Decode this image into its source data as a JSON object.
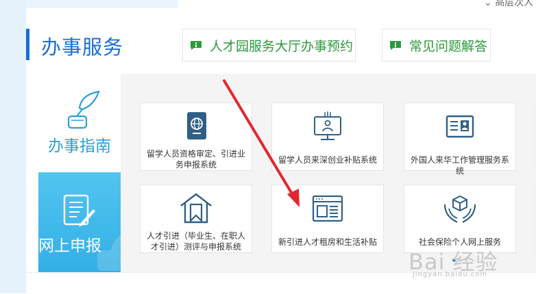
{
  "header": {
    "top_right_text": "高层次人"
  },
  "section": {
    "title": "办事服务"
  },
  "quick_links": [
    {
      "label": "人才园服务大厅办事预约"
    },
    {
      "label": "常见问题解答"
    }
  ],
  "tabs": {
    "guide": {
      "label": "办事指南"
    },
    "apply": {
      "label": "网上申报"
    }
  },
  "services": [
    {
      "label": "留学人员资格审定、引进业务申报系统",
      "icon": "passport-icon"
    },
    {
      "label": "留学人员来深创业补贴系统",
      "icon": "monitor-person-icon"
    },
    {
      "label": "外国人来华工作管理服务系统",
      "icon": "id-card-icon"
    },
    {
      "label": "人才引进（毕业生、在职人才引进）测评与申报系统",
      "icon": "house-bookmark-icon"
    },
    {
      "label": "新引进人才租房和生活补贴",
      "icon": "webpage-icon"
    },
    {
      "label": "社会保险个人网上服务",
      "icon": "hands-box-icon"
    }
  ],
  "watermark": {
    "logo": "Bai 经验",
    "sub": "jingyan.baidu.com"
  },
  "colors": {
    "brand_blue": "#1a6fd0",
    "green": "#2b9a3b",
    "tab_blue": "#2a9fd6",
    "arrow_red": "#e3262e"
  }
}
